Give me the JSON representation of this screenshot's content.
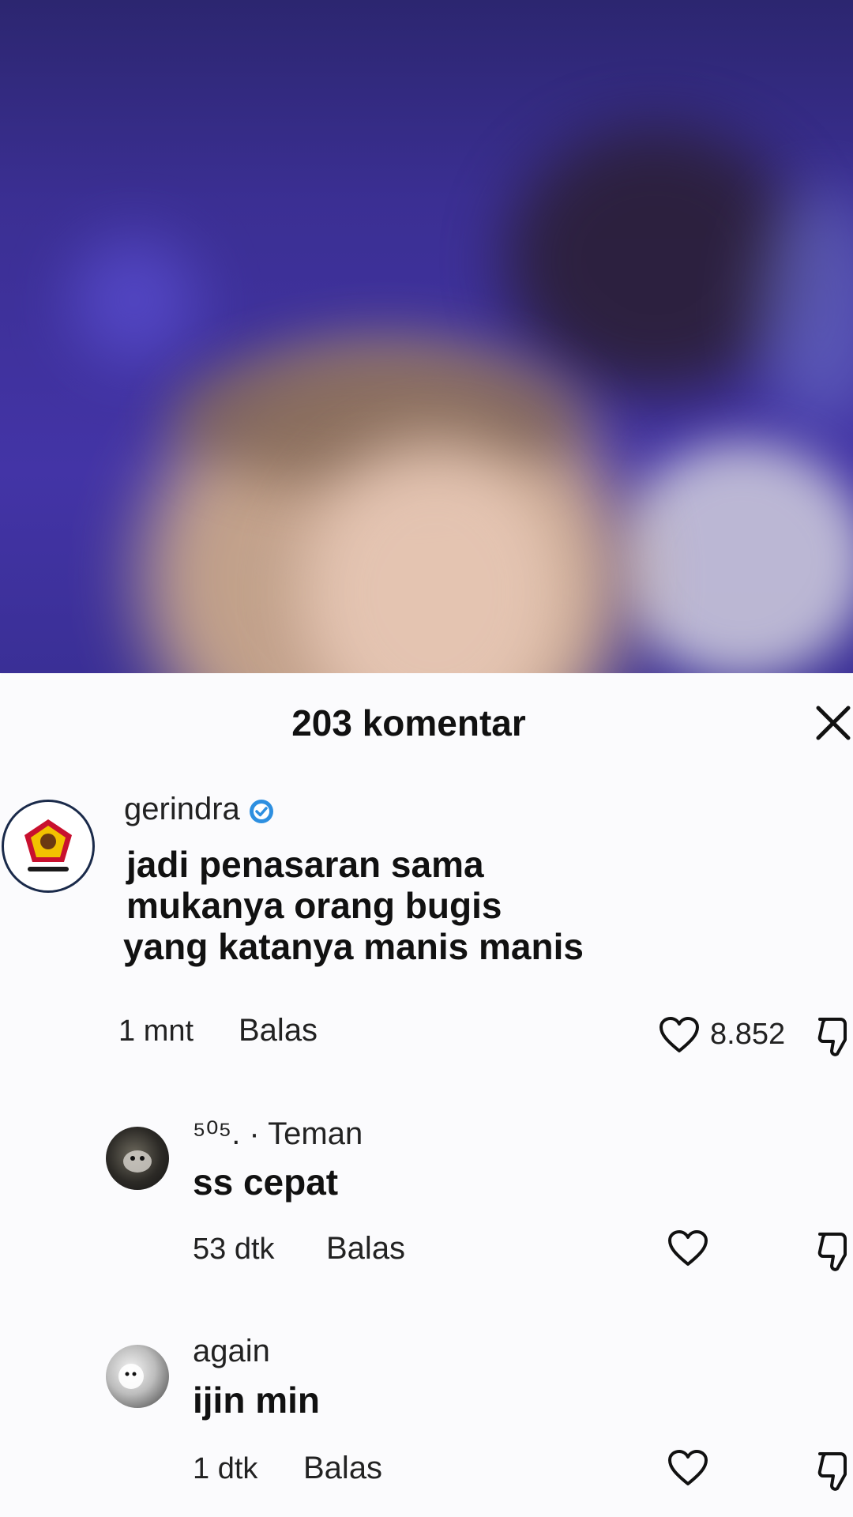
{
  "sheet": {
    "title": "203 komentar"
  },
  "comments": [
    {
      "username": "gerindra",
      "verified": true,
      "text_lines": [
        "jadi penasaran sama",
        "mukanya orang bugis",
        "yang katanya manis manis"
      ],
      "time": "1 mnt",
      "reply_label": "Balas",
      "likes": "8.852"
    },
    {
      "username": "⁵⁰⁵. · Teman",
      "text": "ss cepat",
      "time": "53 dtk",
      "reply_label": "Balas"
    },
    {
      "username": "again",
      "text": "ijin min",
      "time": "1 dtk",
      "reply_label": "Balas"
    }
  ],
  "colors": {
    "verified_badge": "#2d8fe0",
    "accent_red": "#c8102e",
    "accent_yellow": "#f2c200"
  }
}
